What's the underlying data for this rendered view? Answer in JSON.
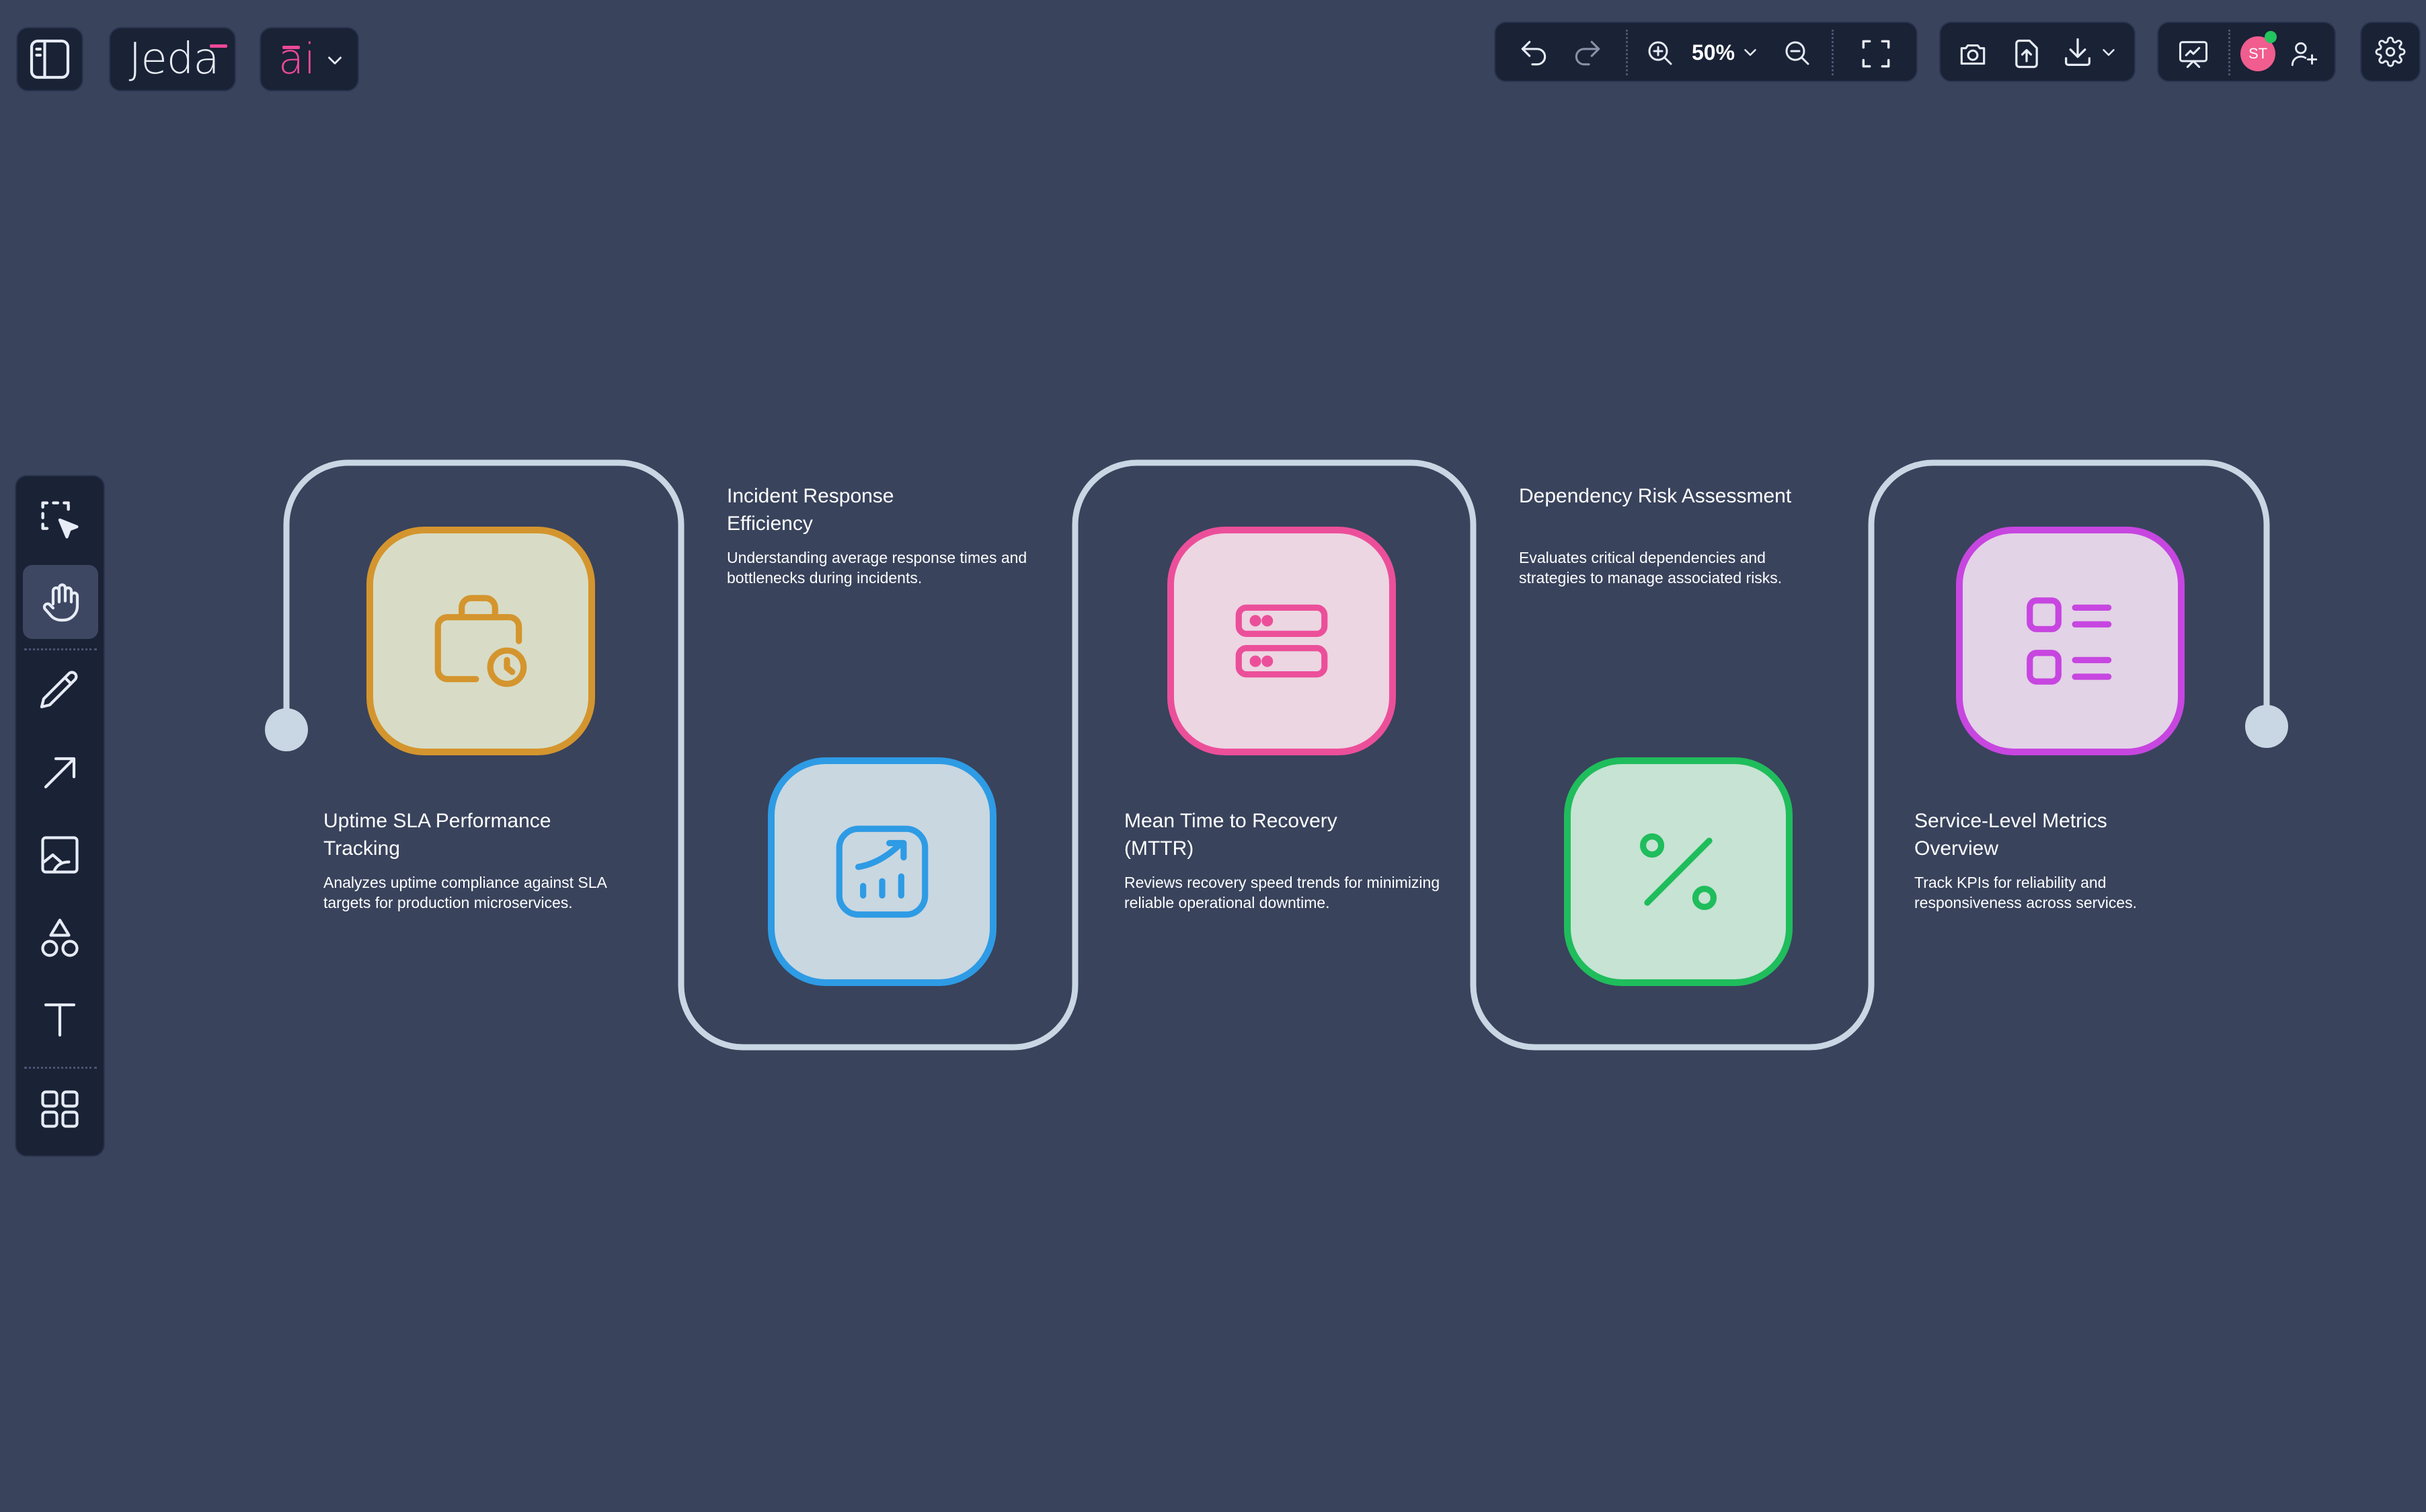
{
  "app": {
    "logo_text": "Jeda",
    "ai_badge": "ai"
  },
  "toolbar": {
    "zoom_value": "50%"
  },
  "user": {
    "initials": "ST",
    "avatar_color": "#f05d8e",
    "presence_color": "#22c55e"
  },
  "theme": {
    "background": "#39435c",
    "panel": "#1a2236",
    "connector": "#c9d6e3",
    "accent_pink": "#ec4899"
  },
  "icons": {
    "sidebar_toggle": "sidebar-toggle-icon",
    "undo": "undo-icon",
    "redo": "redo-icon",
    "zoom_in": "zoom-in-icon",
    "zoom_out": "zoom-out-icon",
    "fit": "fit-screen-icon",
    "camera": "camera-icon",
    "share": "share-icon",
    "download": "download-icon",
    "present": "present-icon",
    "add_user": "add-user-icon",
    "settings": "gear-icon",
    "select": "select-icon",
    "hand": "hand-icon",
    "pen": "pen-icon",
    "arrow": "arrow-icon",
    "image": "image-icon",
    "shapes": "shapes-icon",
    "text": "text-icon",
    "templates": "grid-icon"
  },
  "steps": [
    {
      "title": "Uptime SLA Performance Tracking",
      "description": "Analyzes uptime compliance against SLA targets for production microservices.",
      "icon": "briefcase-clock-icon",
      "color": "#d4952e",
      "fill": "#d8dcc6"
    },
    {
      "title": "Incident Response Efficiency",
      "description": "Understanding average response times and bottlenecks during incidents.",
      "icon": "chart-up-icon",
      "color": "#2e9be5",
      "fill": "#c9d7e0"
    },
    {
      "title": "Mean Time to Recovery (MTTR)",
      "description": "Reviews recovery speed trends for minimizing reliable operational downtime.",
      "icon": "server-icon",
      "color": "#ec4f9a",
      "fill": "#ecd6e2"
    },
    {
      "title": "Dependency Risk Assessment",
      "description": "Evaluates critical dependencies and strategies to manage associated risks.",
      "icon": "percent-icon",
      "color": "#1fbd5c",
      "fill": "#c6e3d3"
    },
    {
      "title": "Service-Level Metrics Overview",
      "description": "Track KPIs for reliability and responsiveness across services.",
      "icon": "list-icon",
      "color": "#c746e0",
      "fill": "#e2d3e6"
    }
  ]
}
